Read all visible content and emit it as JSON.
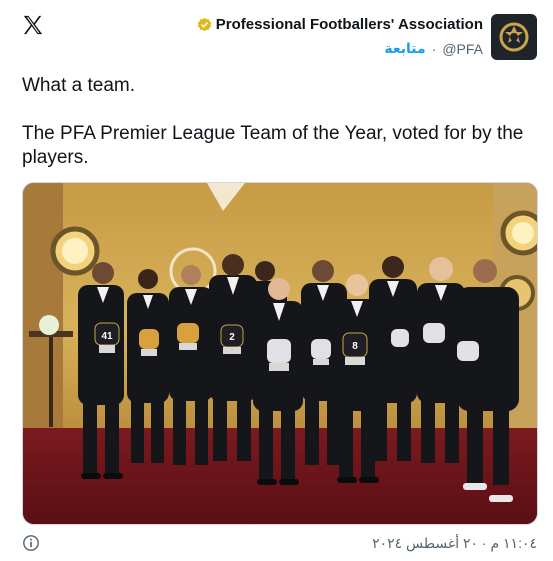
{
  "header": {
    "display_name": "Professional Footballers' Association",
    "handle": "@PFA",
    "separator": "·",
    "follow_label": "متابعة"
  },
  "tweet": {
    "line1": "What a team.",
    "line2": "The PFA Premier League Team of the Year, voted for by the players."
  },
  "media": {
    "jersey_numbers": [
      "41",
      "2",
      "8"
    ]
  },
  "footer": {
    "timestamp": "١١:٠٤ م · ٢٠ أغسطس ٢٠٢٤"
  },
  "colors": {
    "accent": "#1d9bf0",
    "verified": "#e2b719",
    "secondary_text": "#536471"
  },
  "icons": {
    "logo": "x-logo-icon",
    "verified": "verified-badge-icon",
    "info": "info-icon"
  }
}
